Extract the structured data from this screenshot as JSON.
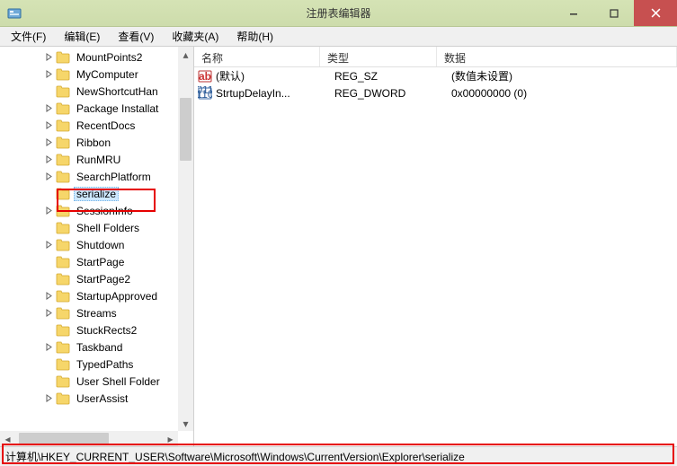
{
  "window": {
    "title": "注册表编辑器"
  },
  "menu": {
    "file": "文件(F)",
    "edit": "编辑(E)",
    "view": "查看(V)",
    "favorites": "收藏夹(A)",
    "help": "帮助(H)"
  },
  "tree": {
    "items": [
      {
        "indent": 48,
        "exp": "closed",
        "label": "MountPoints2"
      },
      {
        "indent": 48,
        "exp": "closed",
        "label": "MyComputer"
      },
      {
        "indent": 48,
        "exp": "none",
        "label": "NewShortcutHan"
      },
      {
        "indent": 48,
        "exp": "closed",
        "label": "Package Installat"
      },
      {
        "indent": 48,
        "exp": "closed",
        "label": "RecentDocs"
      },
      {
        "indent": 48,
        "exp": "closed",
        "label": "Ribbon"
      },
      {
        "indent": 48,
        "exp": "closed",
        "label": "RunMRU"
      },
      {
        "indent": 48,
        "exp": "closed",
        "label": "SearchPlatform"
      },
      {
        "indent": 48,
        "exp": "none",
        "label": "serialize",
        "selected": true
      },
      {
        "indent": 48,
        "exp": "closed",
        "label": "SessionInfo"
      },
      {
        "indent": 48,
        "exp": "none",
        "label": "Shell Folders"
      },
      {
        "indent": 48,
        "exp": "closed",
        "label": "Shutdown"
      },
      {
        "indent": 48,
        "exp": "none",
        "label": "StartPage"
      },
      {
        "indent": 48,
        "exp": "none",
        "label": "StartPage2"
      },
      {
        "indent": 48,
        "exp": "closed",
        "label": "StartupApproved"
      },
      {
        "indent": 48,
        "exp": "closed",
        "label": "Streams"
      },
      {
        "indent": 48,
        "exp": "none",
        "label": "StuckRects2"
      },
      {
        "indent": 48,
        "exp": "closed",
        "label": "Taskband"
      },
      {
        "indent": 48,
        "exp": "none",
        "label": "TypedPaths"
      },
      {
        "indent": 48,
        "exp": "none",
        "label": "User Shell Folder"
      },
      {
        "indent": 48,
        "exp": "closed",
        "label": "UserAssist"
      }
    ]
  },
  "list": {
    "headers": {
      "name": "名称",
      "type": "类型",
      "data": "数据"
    },
    "rows": [
      {
        "icon": "string",
        "name": "(默认)",
        "type": "REG_SZ",
        "data": "(数值未设置)"
      },
      {
        "icon": "binary",
        "name": "StrtupDelayIn...",
        "type": "REG_DWORD",
        "data": "0x00000000 (0)"
      }
    ]
  },
  "status": {
    "path": "计算机\\HKEY_CURRENT_USER\\Software\\Microsoft\\Windows\\CurrentVersion\\Explorer\\serialize"
  }
}
